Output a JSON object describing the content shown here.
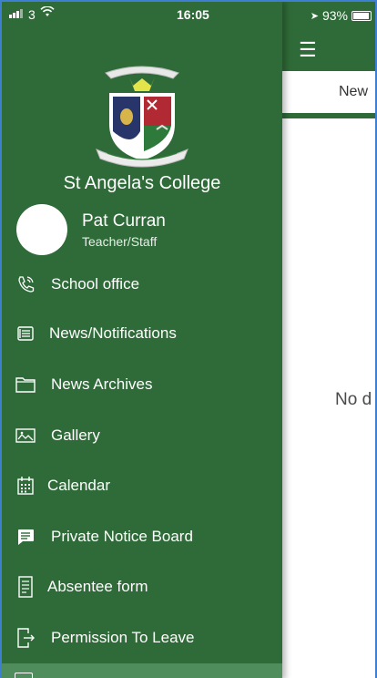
{
  "status_bar": {
    "carrier": "3",
    "time": "16:05",
    "battery": "93%"
  },
  "main": {
    "tab_label": "New",
    "empty_text": "No d"
  },
  "drawer": {
    "college_name": "St Angela's College",
    "user": {
      "name": "Pat Curran",
      "role": "Teacher/Staff"
    },
    "menu": [
      {
        "label": "School office",
        "icon": "phone-icon"
      },
      {
        "label": "News/Notifications",
        "icon": "news-icon"
      },
      {
        "label": "News Archives",
        "icon": "folder-icon"
      },
      {
        "label": "Gallery",
        "icon": "image-icon"
      },
      {
        "label": "Calendar",
        "icon": "calendar-icon"
      },
      {
        "label": "Private Notice Board",
        "icon": "message-icon"
      },
      {
        "label": "Absentee form",
        "icon": "form-icon"
      },
      {
        "label": "Permission To Leave",
        "icon": "exit-icon"
      }
    ]
  },
  "colors": {
    "drawer_bg": "#2f6b38",
    "selected_bg": "#4f8e5c",
    "frame_border": "#3e7fd1"
  }
}
